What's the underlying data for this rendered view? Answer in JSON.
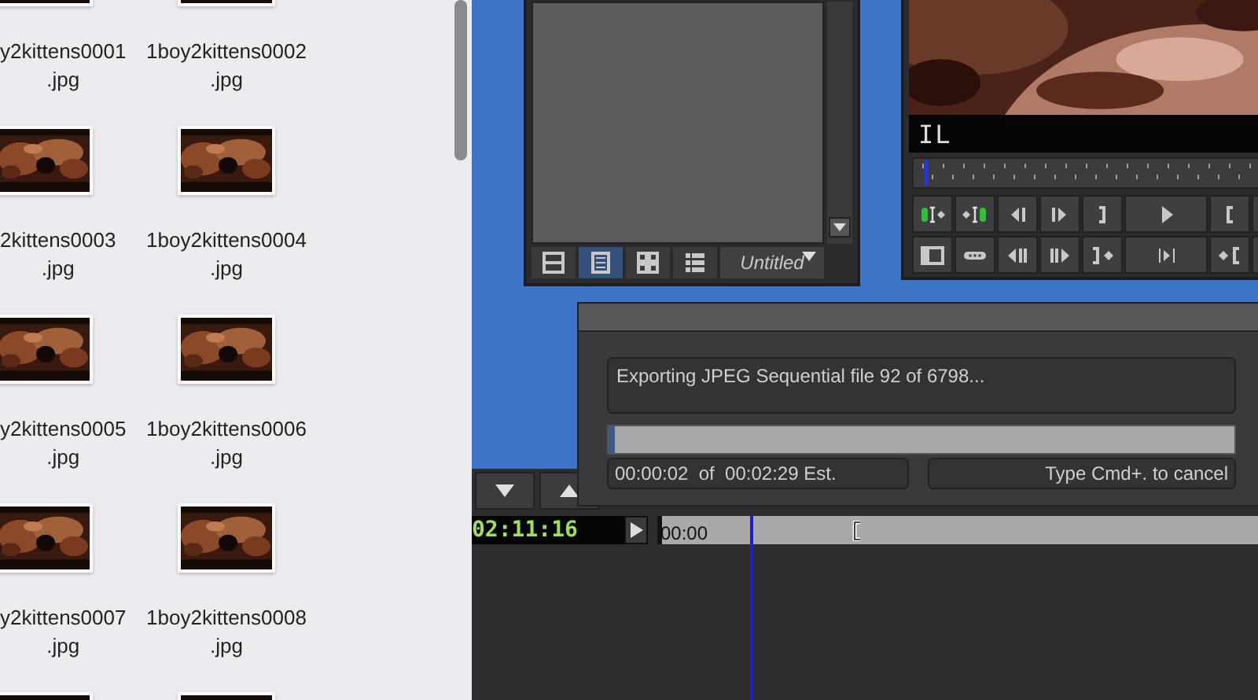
{
  "finder": {
    "files": [
      {
        "kind": "picture",
        "label_lines": [
          "y2kittens0001",
          ".jpg"
        ]
      },
      {
        "kind": "picture",
        "label_lines": [
          "1boy2kittens0002",
          ".jpg"
        ]
      },
      {
        "kind": "picture",
        "label_lines": [
          "2kittens0003",
          ".jpg"
        ]
      },
      {
        "kind": "picture",
        "label_lines": [
          "1boy2kittens0004",
          ".jpg"
        ]
      },
      {
        "kind": "picture",
        "label_lines": [
          "y2kittens0005",
          ".jpg"
        ]
      },
      {
        "kind": "picture",
        "label_lines": [
          "1boy2kittens0006",
          ".jpg"
        ]
      },
      {
        "kind": "picture",
        "label_lines": [
          "y2kittens0007",
          ".jpg"
        ]
      },
      {
        "kind": "picture",
        "label_lines": [
          "1boy2kittens0008",
          ".jpg"
        ]
      },
      {
        "kind": "picture"
      },
      {
        "kind": "picture"
      }
    ]
  },
  "bin": {
    "view_buttons": [
      {
        "kind": "frame",
        "selected": false
      },
      {
        "kind": "text",
        "selected": true
      },
      {
        "kind": "grid",
        "selected": false
      },
      {
        "kind": "list",
        "selected": false
      }
    ],
    "title": "Untitled"
  },
  "monitor": {
    "info": "IL",
    "position": {
      "level": 0.03
    }
  },
  "export_dialog": {
    "message": "Exporting JPEG Sequential file 92 of 6798...",
    "progress": {
      "level": 0.01
    },
    "elapsed": "00:00:02  of  00:02:29 Est.",
    "cancel_hint": "Type Cmd+. to cancel"
  },
  "timeline": {
    "timecode": "02:11:16",
    "ruler_start": "00:00"
  }
}
